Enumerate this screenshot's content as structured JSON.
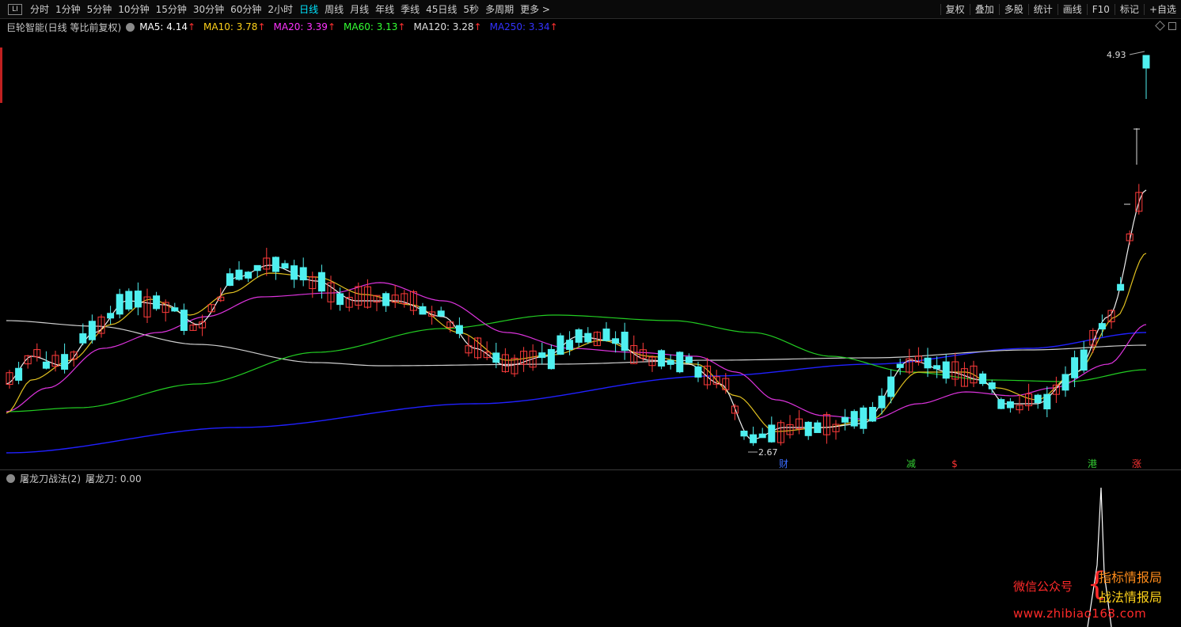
{
  "toolbar": {
    "first_icon_label": "LI",
    "periods": [
      "分时",
      "1分钟",
      "5分钟",
      "10分钟",
      "15分钟",
      "30分钟",
      "60分钟",
      "2小时",
      "日线",
      "周线",
      "月线",
      "年线",
      "季线",
      "45日线",
      "5秒",
      "多周期",
      "更多 >"
    ],
    "active_period": "日线",
    "tools": [
      "复权",
      "叠加",
      "多股",
      "统计",
      "画线",
      "F10",
      "标记",
      "+自选"
    ]
  },
  "main_header": {
    "stock_title": "巨轮智能(日线 等比前复权)",
    "ma": [
      {
        "label": "MA5: 4.14",
        "color": "#ffffff",
        "arrow": "↑"
      },
      {
        "label": "MA10: 3.78",
        "color": "#ffd21a",
        "arrow": "↑"
      },
      {
        "label": "MA20: 3.39",
        "color": "#ff33ff",
        "arrow": "↑"
      },
      {
        "label": "MA60: 3.13",
        "color": "#33ff33",
        "arrow": "↑"
      },
      {
        "label": "MA120: 3.28",
        "color": "#e0e0e0",
        "arrow": "↑"
      },
      {
        "label": "MA250: 3.34",
        "color": "#3333ff",
        "arrow": "↑"
      }
    ]
  },
  "chart_data": {
    "type": "candlestick",
    "annotations": {
      "high_label": "4.93",
      "low_label": "2.67"
    },
    "event_markers": [
      {
        "label": "财",
        "color": "#3a6cff"
      },
      {
        "label": "减",
        "color": "#33cc33"
      },
      {
        "label": "$",
        "color": "#ff3333"
      },
      {
        "label": "港",
        "color": "#33cc33"
      },
      {
        "label": "涨",
        "color": "#ff3333"
      }
    ],
    "colors": {
      "up": "#ff3b3b",
      "down": "#4ff0f0"
    }
  },
  "indicator": {
    "title": "屠龙刀战法(2)",
    "value_label": "屠龙刀: 0.00"
  },
  "watermark": {
    "label": "微信公众号",
    "line1": "指标情报局",
    "line2": "战法情报局",
    "url": "www.zhibiao168.com"
  }
}
